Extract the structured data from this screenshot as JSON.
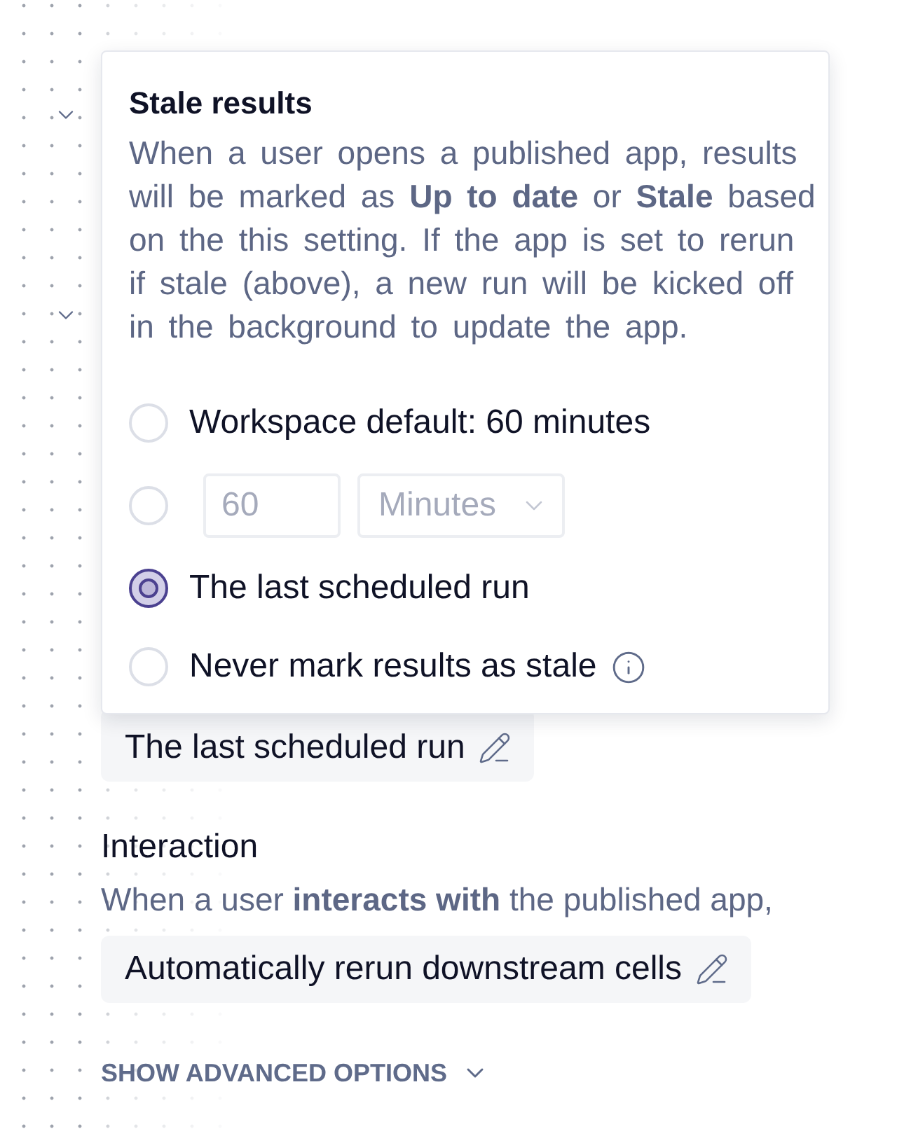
{
  "popover": {
    "title": "Stale results",
    "description": "When a user opens a published app, results will be marked as **Up to date** or **Stale** based on the this setting. If the app is set to rerun if stale (above), a new run will be kicked off in the background to update the app.",
    "options": [
      {
        "kind": "plain",
        "label": "Workspace default: 60 minutes",
        "selected": false
      },
      {
        "kind": "duration",
        "value": "60",
        "unit": "Minutes",
        "disabled": true,
        "selected": false
      },
      {
        "kind": "plain",
        "label": "The last scheduled run",
        "selected": true
      },
      {
        "kind": "info",
        "label": "Never mark results as stale",
        "selected": false
      }
    ]
  },
  "stale_setting": {
    "value": "The last scheduled run"
  },
  "interaction": {
    "title": "Interaction",
    "description": "When a user **interacts with** the published app,",
    "value": "Automatically rerun downstream cells"
  },
  "advanced_toggle": {
    "label": "SHOW ADVANCED OPTIONS",
    "expanded": false
  }
}
